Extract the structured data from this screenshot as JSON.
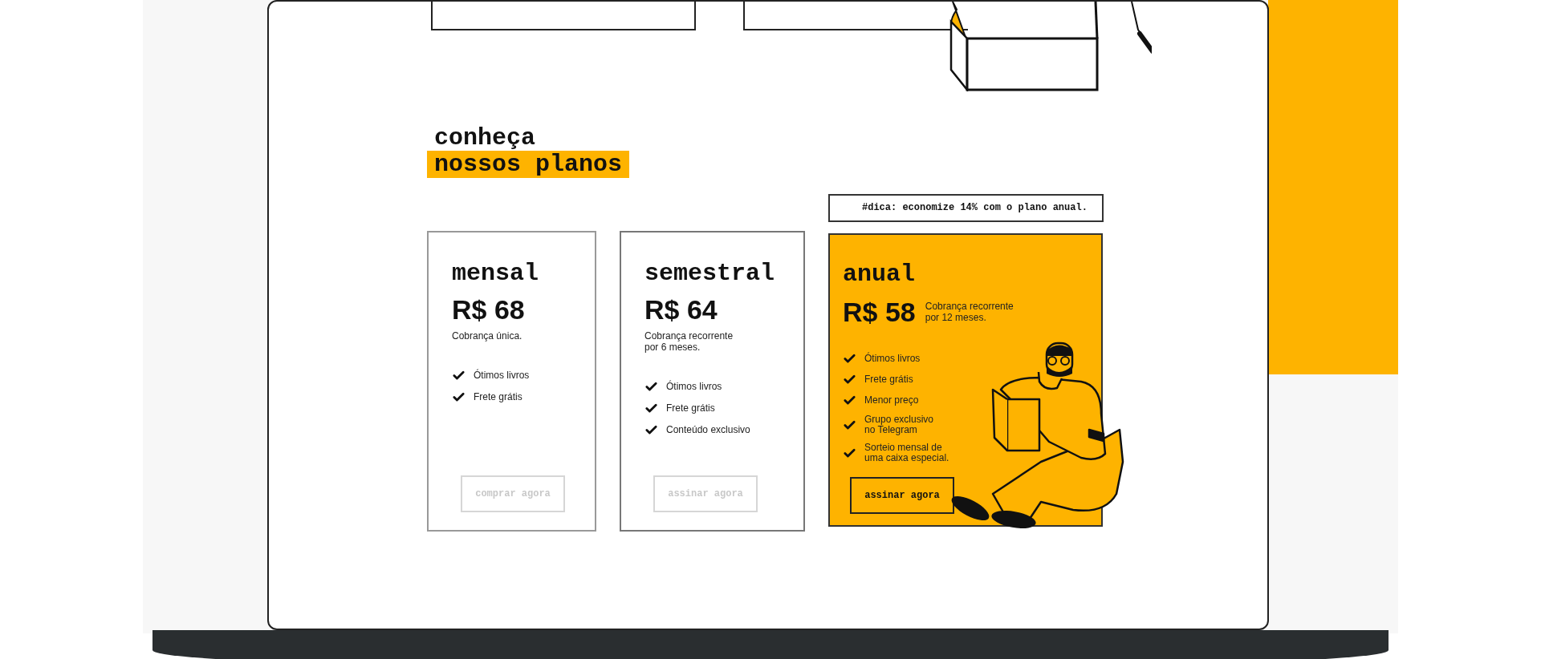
{
  "heading": {
    "line1": "conheça",
    "line2": "nossos planos"
  },
  "tip": {
    "text": "#dica: economize **14%** com o plano anual."
  },
  "plans": [
    {
      "name": "mensal",
      "price": "R$ 68",
      "billing": "Cobrança única.",
      "features": [
        "Ótimos livros",
        "Frete grátis"
      ],
      "button": "comprar agora",
      "disabled": true,
      "highlighted": false
    },
    {
      "name": "semestral",
      "price": "R$ 64",
      "billing": "Cobrança recorrente\npor 6 meses.",
      "features": [
        "Ótimos livros",
        "Frete grátis",
        "Conteúdo exclusivo"
      ],
      "button": "assinar agora",
      "disabled": true,
      "highlighted": false
    },
    {
      "name": "anual",
      "price": "R$ 58",
      "billing": "Cobrança recorrente\npor 12 meses.",
      "features": [
        "Ótimos livros",
        "Frete grátis",
        "Menor preço",
        "Grupo exclusivo\nno Telegram",
        "Sorteio mensal de\numa caixa especial."
      ],
      "button": "assinar agora",
      "disabled": false,
      "highlighted": true
    }
  ]
}
